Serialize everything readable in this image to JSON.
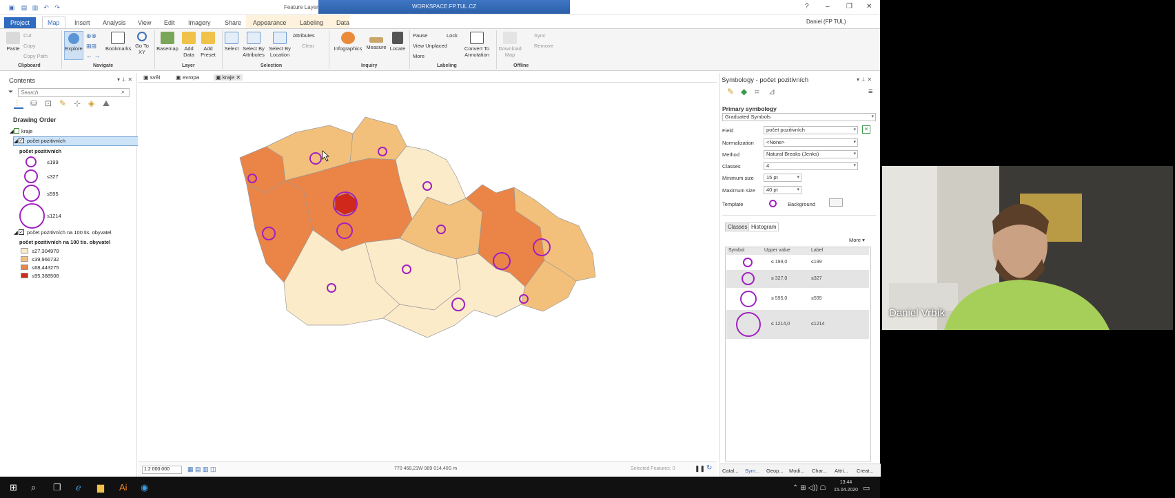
{
  "window": {
    "context_label": "Feature Layer",
    "workspace": "WORKSPACE.FP.TUL.CZ",
    "user": "Daniel (FP TUL)"
  },
  "tabs": [
    "Project",
    "Map",
    "Insert",
    "Analysis",
    "View",
    "Edit",
    "Imagery",
    "Share",
    "Appearance",
    "Labeling",
    "Data"
  ],
  "ribbon": {
    "clipboard": {
      "paste": "Paste",
      "cut": "Cut",
      "copy": "Copy",
      "copy_path": "Copy Path",
      "group": "Clipboard"
    },
    "navigate": {
      "explore": "Explore",
      "bookmarks": "Bookmarks",
      "goto": "Go To XY",
      "group": "Navigate"
    },
    "layer": {
      "basemap": "Basemap",
      "add_data": "Add Data",
      "add_preset": "Add Preset",
      "group": "Layer"
    },
    "selection": {
      "select": "Select",
      "select_attr": "Select By Attributes",
      "select_loc": "Select By Location",
      "attributes": "Attributes",
      "clear": "Clear",
      "group": "Selection"
    },
    "inquiry": {
      "infographics": "Infographics",
      "measure": "Measure",
      "locate": "Locate",
      "group": "Inquiry"
    },
    "labeling": {
      "pause": "Pause",
      "lock": "Lock",
      "view_unplaced": "View Unplaced",
      "more": "More",
      "convert": "Convert To Annotation",
      "group": "Labeling"
    },
    "offline": {
      "download": "Download Map",
      "sync": "Sync",
      "remove": "Remove",
      "group": "Offline"
    }
  },
  "contents": {
    "title": "Contents",
    "search_placeholder": "Search",
    "drawing_order": "Drawing Order",
    "root": "kraje",
    "layer1": "počet pozitivních",
    "layer1_field": "počet pozitivních",
    "layer1_classes": [
      "≤199",
      "≤327",
      "≤595",
      "≤1214"
    ],
    "layer2": "počet pozitivních na 100 tis. obyvatel",
    "layer2_field": "počet pozitivních na 100 tis. obyvatel",
    "layer2_classes": [
      {
        "label": "≤27,304978",
        "color": "#fcebc9"
      },
      {
        "label": "≤39,966732",
        "color": "#f3c07b"
      },
      {
        "label": "≤68,443275",
        "color": "#ea8447"
      },
      {
        "label": "≤95,388508",
        "color": "#d0281b"
      }
    ]
  },
  "map": {
    "tabs": [
      "svět",
      "evropa",
      "kraje"
    ],
    "scale": "1:2 000 000",
    "coords": "770 468,21W 989 014,40S m",
    "selected": "Selected Features: 0"
  },
  "symbology": {
    "title": "Symbology - počet pozitivních",
    "primary": "Primary symbology",
    "type": "Graduated Symbols",
    "field_label": "Field",
    "field": "počet pozitivních",
    "norm_label": "Normalization",
    "norm": "<None>",
    "method_label": "Method",
    "method": "Natural Breaks (Jenks)",
    "classes_label": "Classes",
    "classes": "4",
    "min_label": "Minimum size",
    "min": "15 pt",
    "max_label": "Maximum size",
    "max": "40 pt",
    "template_label": "Template",
    "background_label": "Background",
    "tab_classes": "Classes",
    "tab_histogram": "Histogram",
    "more": "More",
    "col_symbol": "Symbol",
    "col_upper": "Upper value",
    "col_label": "Label",
    "rows": [
      {
        "upper": "≤  199,0",
        "label": "≤199"
      },
      {
        "upper": "≤  327,0",
        "label": "≤327"
      },
      {
        "upper": "≤  595,0",
        "label": "≤595"
      },
      {
        "upper": "≤  1214,0",
        "label": "≤1214"
      }
    ],
    "bottom_tabs": [
      "Catal...",
      "Sym...",
      "Geop...",
      "Modi...",
      "Char...",
      "Attri...",
      "Creat..."
    ]
  },
  "webcam": {
    "name": "Daniel Vrbík"
  },
  "clock": {
    "time": "13:44",
    "date": "15.04.2020"
  }
}
